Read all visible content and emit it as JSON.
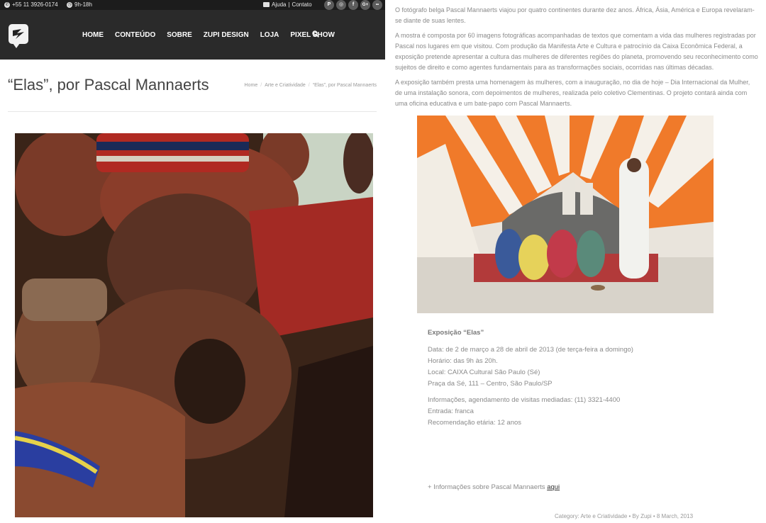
{
  "topbar": {
    "phone": "+55 11 3926-0174",
    "hours": "9h-18h",
    "help_link": "Ajuda",
    "separator": "|",
    "contact_link": "Contato",
    "social": [
      {
        "icon": "pinterest-icon",
        "glyph": "P"
      },
      {
        "icon": "instagram-icon",
        "glyph": "◎"
      },
      {
        "icon": "facebook-icon",
        "glyph": "f"
      },
      {
        "icon": "google-plus-icon",
        "glyph": "G+"
      },
      {
        "icon": "flickr-icon",
        "glyph": "••"
      }
    ]
  },
  "nav": {
    "items": [
      "HOME",
      "CONTEÚDO",
      "SOBRE",
      "ZUPI DESIGN",
      "LOJA",
      "PIXEL SHOW"
    ]
  },
  "page": {
    "title": "“Elas”, por Pascal Mannaerts",
    "breadcrumbs": [
      "Home",
      "Arte e Criatividade",
      "“Elas”, por Pascal Mannaerts"
    ],
    "crumb_sep": "/"
  },
  "article": {
    "p1": "O fotógrafo belga Pascal Mannaerts viajou por quatro continentes durante dez anos. África, Ásia, América e Europa revelaram-se diante de suas lentes.",
    "p2": "A mostra é composta por 60 imagens fotográficas acompanhadas de textos que comentam a vida das mulheres registradas por Pascal nos lugares em que visitou. Com produção da Manifesta Arte e Cultura e patrocínio da Caixa Econômica Federal, a exposição pretende apresentar a cultura das mulheres de diferentes regiões do planeta, promovendo seu reconhecimento como sujeitos de direito e como agentes fundamentais para as transformações sociais, ocorridas nas últimas décadas.",
    "p3": "A exposição também presta uma homenagem às mulheres, com a inauguração, no dia de hoje – Dia Internacional da Mulher, de uma instalação sonora, com depoimentos de mulheres, realizada pelo coletivo Clementinas. O projeto contará ainda com uma oficina educativa e um bate-papo com Pascal Mannaerts.",
    "expo_title": "Exposição “Elas”",
    "date": "Data: de 2 de março a 28 de abril de 2013 (de terça-feira a domingo)",
    "time": "Horário: das 9h às 20h.",
    "location": "Local: CAIXA Cultural São Paulo (Sé)",
    "address": "Praça da Sé, 111 – Centro, São Paulo/SP",
    "info": "Informações, agendamento de visitas mediadas: (11) 3321-4400",
    "entry": "Entrada: franca",
    "age": "Recomendação etária: 12 anos",
    "more_text": "+ Informações sobre Pascal Mannaerts ",
    "more_link": "aqui",
    "meta": "Category: Arte e Criatividade • By Zupi • 8 March, 2013"
  },
  "colors": {
    "topbar_bg": "#1c1c1c",
    "nav_bg": "#2a2a2a",
    "text": "#8a8a8a",
    "title": "#444444"
  }
}
